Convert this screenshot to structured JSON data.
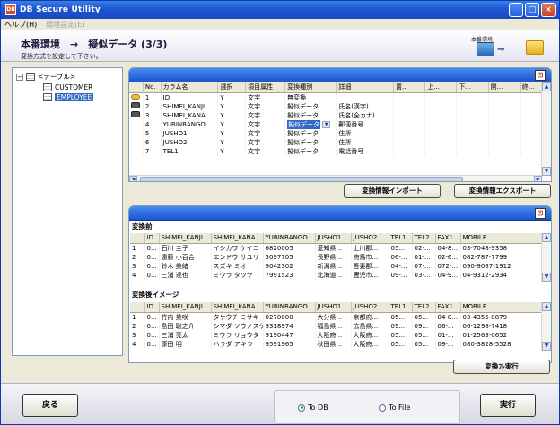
{
  "window": {
    "title": "DB Secure Utility",
    "app_icon": "DB"
  },
  "menu": {
    "items": [
      {
        "label": "ヘルプ(H)",
        "enabled": true
      },
      {
        "label": "環境設定(E)",
        "enabled": false
      }
    ]
  },
  "header": {
    "title": "本番環境　→　擬似データ (3/3)",
    "subtitle": "変換方式を設定して下さい。",
    "env_label": "本番環境"
  },
  "tree": {
    "root": "<テーブル>",
    "toggle": "−",
    "children": [
      "CUSTOMER",
      "EMPLOYEE"
    ],
    "selected": "EMPLOYEE"
  },
  "column_grid": {
    "headers": [
      "",
      "No.",
      "カラム名",
      "選択",
      "項目属性",
      "変換種別",
      "詳細",
      "置...",
      "上...",
      "下...",
      "開...",
      "終..."
    ],
    "rows": [
      {
        "icon": "key-icon",
        "no": "1",
        "name": "ID",
        "sel": "Y",
        "attr": "文字",
        "type": "無変換",
        "detail": ""
      },
      {
        "icon": "column-icon",
        "no": "2",
        "name": "SHIMEI_KANJI",
        "sel": "Y",
        "attr": "文字",
        "type": "擬似データ",
        "detail": "氏名(漢字)"
      },
      {
        "icon": "column-icon",
        "no": "3",
        "name": "SHIMEI_KANA",
        "sel": "Y",
        "attr": "文字",
        "type": "擬似データ",
        "detail": "氏名(全カナ)"
      },
      {
        "icon": "",
        "no": "4",
        "name": "YUBINBANGO",
        "sel": "Y",
        "attr": "文字",
        "type": "擬似データ",
        "detail": "郵便番号"
      },
      {
        "icon": "",
        "no": "5",
        "name": "JUSHO1",
        "sel": "Y",
        "attr": "文字",
        "type": "擬似データ",
        "detail": "住所"
      },
      {
        "icon": "",
        "no": "6",
        "name": "JUSHO2",
        "sel": "Y",
        "attr": "文字",
        "type": "擬似データ",
        "detail": "住所"
      },
      {
        "icon": "",
        "no": "7",
        "name": "TEL1",
        "sel": "Y",
        "attr": "文字",
        "type": "擬似データ",
        "detail": "電話番号"
      }
    ],
    "import_button": "変換情報インポート",
    "export_button": "変換情報エクスポート"
  },
  "before": {
    "label": "変換前",
    "headers": [
      "",
      "ID",
      "SHIMEI_KANJI",
      "SHIMEI_KANA",
      "YUBINBANGO",
      "JUSHO1",
      "JUSHO2",
      "TEL1",
      "TEL2",
      "FAX1",
      "MOBILE"
    ],
    "rows": [
      [
        "1",
        "0...",
        "石川 圭子",
        "イシカワ ケイコ",
        "6820005",
        "愛知県...",
        "上川郡...",
        "05...",
        "02-...",
        "04-8...",
        "03-7048-9358"
      ],
      [
        "2",
        "0...",
        "遠藤 小百合",
        "エンドウ サユリ",
        "5097705",
        "長野県...",
        "府馬市...",
        "06-...",
        "01-...",
        "02-6...",
        "082-787-7799"
      ],
      [
        "3",
        "0...",
        "鈴木 美緒",
        "スズキ ミオ",
        "9042302",
        "新潟県...",
        "吾妻郡...",
        "04-...",
        "07-...",
        "072-...",
        "090-9087-1912"
      ],
      [
        "4",
        "0...",
        "三浦 達也",
        "ミウラ タツヤ",
        "7991523",
        "北海道...",
        "鹿児市...",
        "09-...",
        "03-...",
        "04-9...",
        "04-9312-2934"
      ]
    ]
  },
  "after": {
    "label": "変換後イメージ",
    "headers": [
      "",
      "ID",
      "SHIMEI_KANJI",
      "SHIMEI_KANA",
      "YUBINBANGO",
      "JUSHO1",
      "JUSHO2",
      "TEL1",
      "TEL2",
      "FAX1",
      "MOBILE"
    ],
    "rows": [
      [
        "1",
        "0...",
        "竹内 美咲",
        "タケウチ ミサキ",
        "0270000",
        "大分県...",
        "京都府...",
        "05...",
        "05...",
        "04-8...",
        "03-4356-0879"
      ],
      [
        "2",
        "0...",
        "島田 聡之介",
        "シマダ ソウノスケ",
        "9318974",
        "福島県...",
        "広島県...",
        "09...",
        "09...",
        "06-...",
        "06-1298-7418"
      ],
      [
        "3",
        "0...",
        "三浦 亮太",
        "ミウラ リョウタ",
        "9190447",
        "大阪府...",
        "大阪府...",
        "05...",
        "05...",
        "01-...",
        "01-2563-0652"
      ],
      [
        "4",
        "0...",
        "原田 明",
        "ハラダ アキラ",
        "9591965",
        "秋田県...",
        "大阪府...",
        "05...",
        "05...",
        "09-...",
        "080-3828-5528"
      ]
    ],
    "test_button": "変換ﾌﾚ実行"
  },
  "footer": {
    "back_button": "戻る",
    "run_button": "実行",
    "radio_db": "To DB",
    "radio_file": "To File",
    "selected": "To DB"
  }
}
